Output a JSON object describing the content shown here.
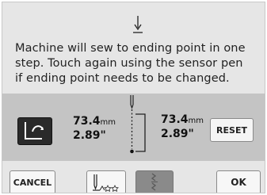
{
  "message": {
    "lines": [
      "Machine will sew to ending point in one",
      "step. Touch again using the sensor pen",
      "if ending point needs to be changed."
    ]
  },
  "left_measure": {
    "mm_value": "73.4",
    "mm_unit": "mm",
    "inch_value": "2.89\""
  },
  "right_measure": {
    "mm_value": "73.4",
    "mm_unit": "mm",
    "inch_value": "2.89\""
  },
  "buttons": {
    "reset": "RESET",
    "cancel": "CANCEL",
    "ok": "OK"
  },
  "icons": {
    "top": "needle-ending-point-icon",
    "change": "change-ending-point-icon",
    "pattern": "needle-pattern-icon",
    "edit": "stitch-edit-icon"
  },
  "colors": {
    "screen_bg": "#e6e6e6",
    "panel_bg": "#c4c4c4",
    "button_bg": "#f7f7f7",
    "dark_button": "#2a2a2a",
    "disabled_button": "#8a8a8a"
  }
}
